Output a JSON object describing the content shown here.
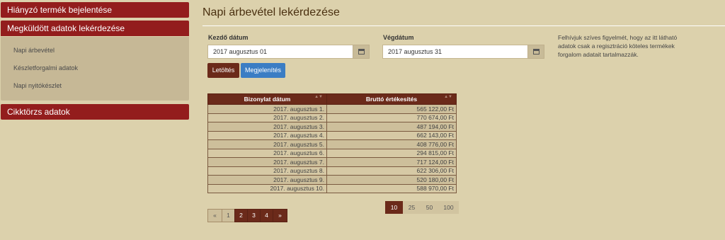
{
  "sidebar": {
    "headers": [
      "Hiányzó termék bejelentése",
      "Megküldött adatok lekérdezése",
      "Cikktörzs adatok"
    ],
    "items": [
      "Napi árbevétel",
      "Készletforgalmi adatok",
      "Napi nyitókészlet"
    ]
  },
  "main": {
    "title": "Napi árbevétel lekérdezése",
    "start_label": "Kezdő dátum",
    "start_value": "2017 augusztus 01",
    "end_label": "Végdátum",
    "end_value": "2017 augusztus 31",
    "download_label": "Letöltés",
    "show_label": "Megjelenítés",
    "notice": "Felhívjuk szíves figyelmét, hogy az itt látható adatok csak a regisztráció köteles termékek forgalom adatait tartalmazzák."
  },
  "table": {
    "headers": [
      "Bizonylat dátum",
      "Bruttó értékesítés"
    ],
    "rows": [
      [
        "2017. augusztus 1.",
        "565 122,00 Ft"
      ],
      [
        "2017. augusztus 2.",
        "770 674,00 Ft"
      ],
      [
        "2017. augusztus 3.",
        "487 194,00 Ft"
      ],
      [
        "2017. augusztus 4.",
        "662 143,00 Ft"
      ],
      [
        "2017. augusztus 5.",
        "408 776,00 Ft"
      ],
      [
        "2017. augusztus 6.",
        "294 815,00 Ft"
      ],
      [
        "2017. augusztus 7.",
        "717 124,00 Ft"
      ],
      [
        "2017. augusztus 8.",
        "622 306,00 Ft"
      ],
      [
        "2017. augusztus 9.",
        "520 180,00 Ft"
      ],
      [
        "2017. augusztus 10.",
        "588 970,00 Ft"
      ]
    ]
  },
  "pagination": {
    "prev": "«",
    "pages": [
      "1",
      "2",
      "3",
      "4"
    ],
    "next": "»",
    "page_sizes": [
      "10",
      "25",
      "50",
      "100"
    ]
  }
}
